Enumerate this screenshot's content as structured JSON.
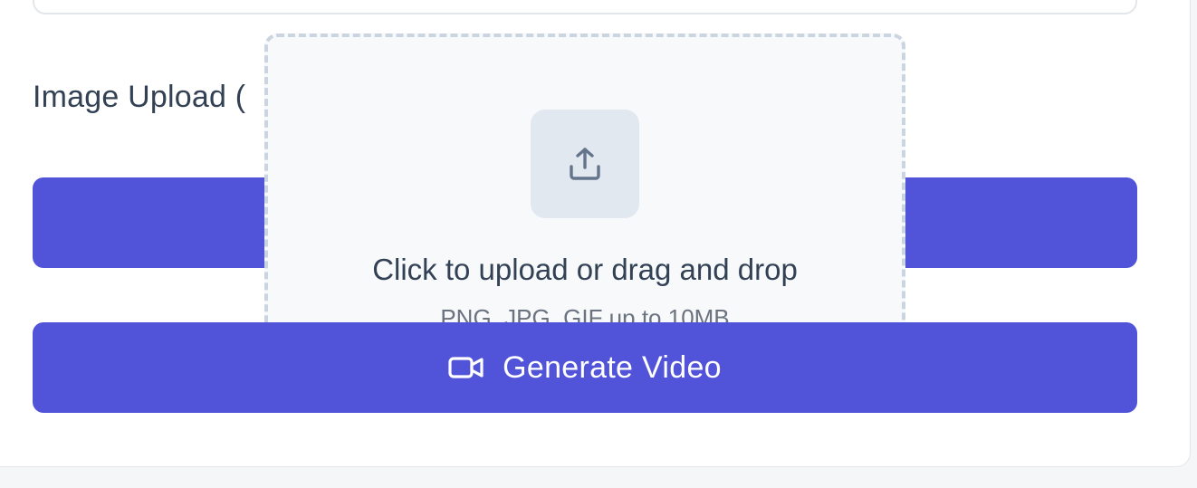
{
  "image_upload": {
    "label": "Image Upload (",
    "dropzone": {
      "title": "Click to upload or drag and drop",
      "subtitle": "PNG, JPG, GIF up to 10MB",
      "icon": "upload-icon"
    }
  },
  "actions": {
    "generate_label": "Generate Video",
    "generate_icon": "video-camera-icon"
  },
  "colors": {
    "primary": "#5153D9",
    "dropzone_bg": "#F7F9FB",
    "dropzone_border": "#CBD5E1",
    "text": "#334155",
    "muted_text": "#6B7280"
  }
}
